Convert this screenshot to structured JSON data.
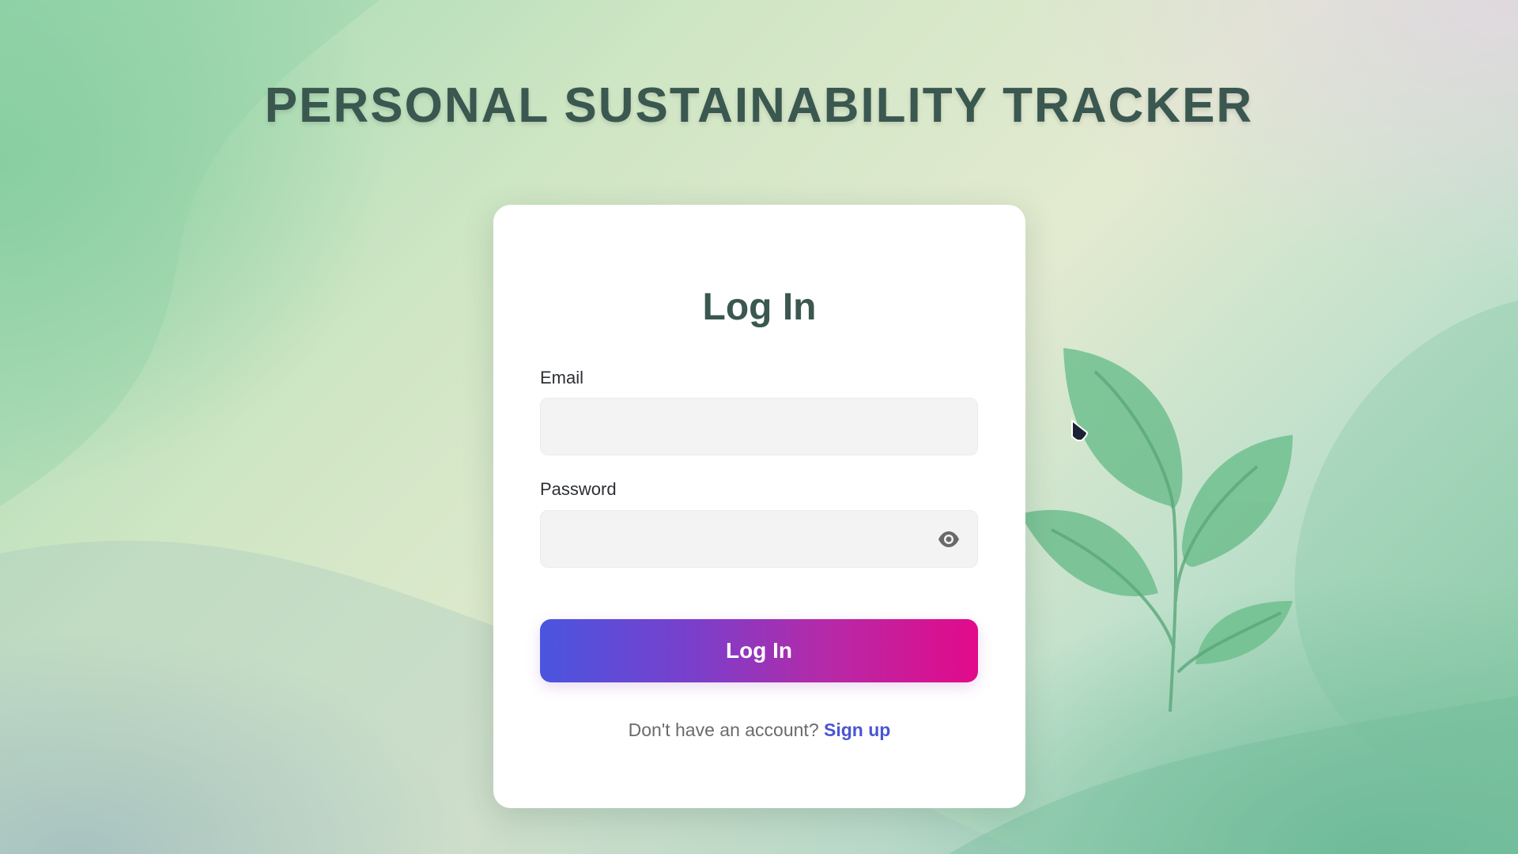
{
  "app": {
    "title": "PERSONAL SUSTAINABILITY TRACKER"
  },
  "login_card": {
    "heading": "Log In",
    "email_label": "Email",
    "email_value": "",
    "password_label": "Password",
    "password_value": "",
    "submit_label": "Log In",
    "signup_prompt": "Don't have an account?",
    "signup_link": "Sign up"
  },
  "icons": {
    "password_toggle": "eye-icon",
    "decoration": "plant-sprout-icon",
    "pointer": "mouse-cursor-icon"
  },
  "colors": {
    "title_text": "#3a5750",
    "button_gradient_start": "#4a55e0",
    "button_gradient_end": "#e20a8a",
    "link": "#4a55d4",
    "input_bg": "#f3f3f3"
  }
}
